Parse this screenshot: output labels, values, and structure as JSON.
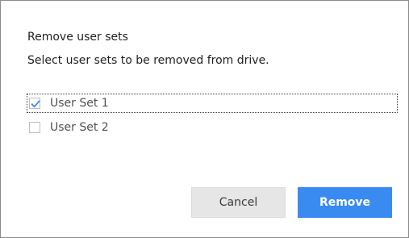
{
  "dialog": {
    "title": "Remove user sets",
    "message": "Select user sets to be removed from drive.",
    "items": [
      {
        "label": "User Set 1",
        "checked": true,
        "focused": true
      },
      {
        "label": "User Set 2",
        "checked": false,
        "focused": false
      }
    ],
    "cancel_label": "Cancel",
    "remove_label": "Remove"
  },
  "colors": {
    "primary": "#3a8bf1",
    "checkmark": "#3a8bf1",
    "secondary_button_bg": "#e6e6e6",
    "border": "#8a8a8a"
  },
  "icons": {
    "checked": "checkmark-icon"
  }
}
